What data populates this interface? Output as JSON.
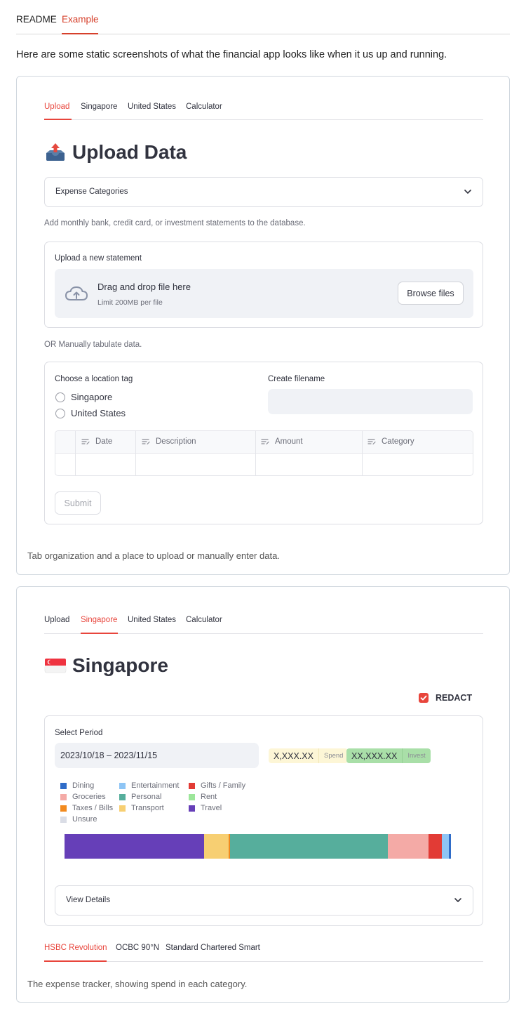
{
  "top_tabs": [
    "README",
    "Example"
  ],
  "intro_text": "Here are some static screenshots of what the financial app looks like when it us up and running.",
  "screenshot1": {
    "tabs": [
      "Upload",
      "Singapore",
      "United States",
      "Calculator"
    ],
    "heading": "Upload Data",
    "expander_label": "Expense Categories",
    "caption_add": "Add monthly bank, credit card, or investment statements to the database.",
    "uploader": {
      "label": "Upload a new statement",
      "drop_title": "Drag and drop file here",
      "drop_limit": "Limit 200MB per file",
      "browse_label": "Browse files"
    },
    "caption_or": "OR Manually tabulate data.",
    "form": {
      "location_label": "Choose a location tag",
      "options": [
        "Singapore",
        "United States"
      ],
      "filename_label": "Create filename",
      "columns": [
        "Date",
        "Description",
        "Amount",
        "Category"
      ],
      "submit_label": "Submit"
    },
    "caption": "Tab organization and a place to upload or manually enter data."
  },
  "screenshot2": {
    "tabs": [
      "Upload",
      "Singapore",
      "United States",
      "Calculator"
    ],
    "heading": "Singapore",
    "redact_label": "REDACT",
    "redact_checked": true,
    "period_label": "Select Period",
    "period_value": "2023/10/18 – 2023/11/15",
    "spend_value": "X,XXX.XX",
    "spend_tag": "Spend",
    "invest_value": "XX,XXX.XX",
    "invest_tag": "Invest",
    "legend": [
      {
        "label": "Dining",
        "color": "#2f6cc8"
      },
      {
        "label": "Entertainment",
        "color": "#8ec5f5"
      },
      {
        "label": "Gifts / Family",
        "color": "#e23b35"
      },
      {
        "label": "Groceries",
        "color": "#f4aaa6"
      },
      {
        "label": "Personal",
        "color": "#56ae9c"
      },
      {
        "label": "Rent",
        "color": "#9ce69a"
      },
      {
        "label": "Taxes / Bills",
        "color": "#f28a1e"
      },
      {
        "label": "Transport",
        "color": "#f7cf72"
      },
      {
        "label": "Travel",
        "color": "#663fb8"
      },
      {
        "label": "Unsure",
        "color": "#dadde6"
      }
    ],
    "spend_shares": [
      {
        "category": "Travel",
        "share": 36.2,
        "color": "#663fb8"
      },
      {
        "category": "Transport",
        "share": 6.2,
        "color": "#f7cf72"
      },
      {
        "category": "Taxes / Bills",
        "share": 0.5,
        "color": "#f28a1e"
      },
      {
        "category": "Personal",
        "share": 40.8,
        "color": "#56ae9c"
      },
      {
        "category": "Groceries",
        "share": 10.5,
        "color": "#f4aaa6"
      },
      {
        "category": "Gifts / Family",
        "share": 3.4,
        "color": "#e23b35"
      },
      {
        "category": "Entertainment",
        "share": 1.9,
        "color": "#8ec5f5"
      },
      {
        "category": "Dining",
        "share": 0.5,
        "color": "#2f6cc8"
      }
    ],
    "expander_label": "View Details",
    "card_tabs": [
      "HSBC Revolution",
      "OCBC 90°N",
      "Standard Chartered Smart"
    ],
    "caption": "The expense tracker, showing spend in each category."
  }
}
